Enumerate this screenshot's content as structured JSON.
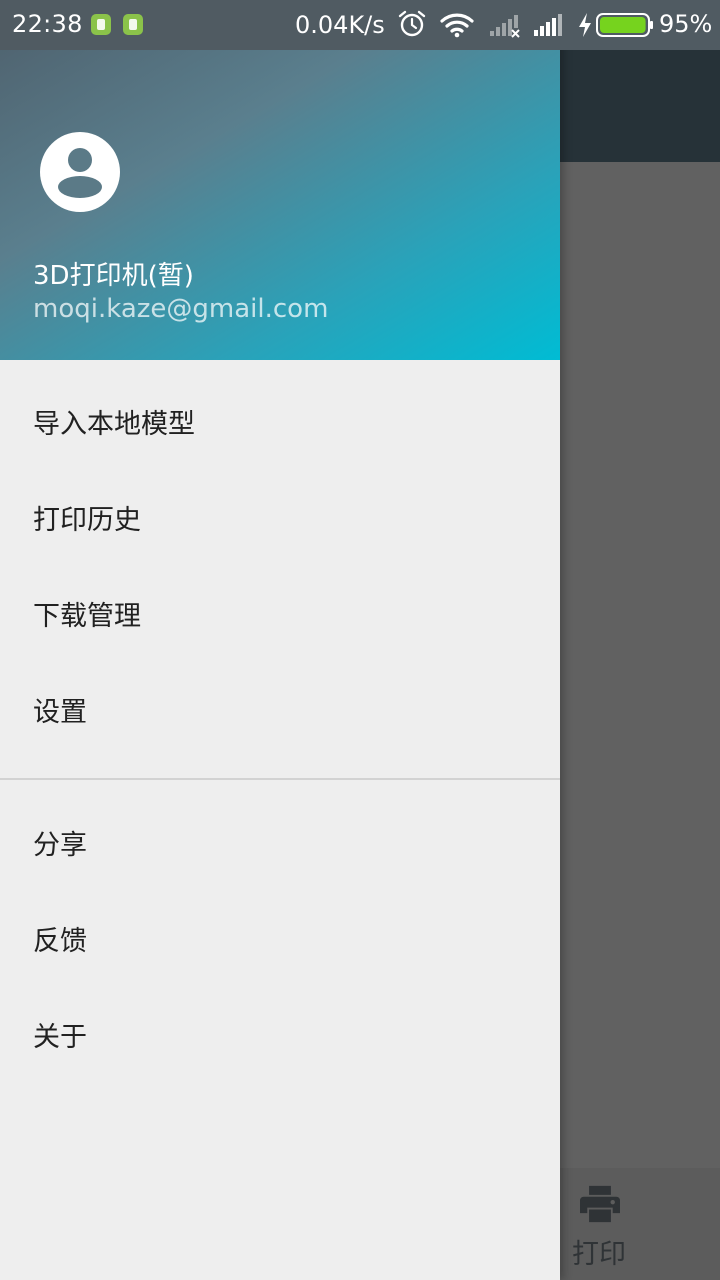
{
  "status_bar": {
    "time": "22:38",
    "net_speed": "0.04K/s",
    "battery_percent": "95%",
    "battery_level": 0.95,
    "icons": [
      "app-notification-icon",
      "android-notification-icon",
      "alarm-icon",
      "wifi-icon",
      "signal-icon",
      "signal-icon",
      "charging-icon",
      "battery-icon"
    ]
  },
  "drawer": {
    "profile": {
      "name": "3D打印机(暂)",
      "email": "moqi.kaze@gmail.com",
      "avatar_icon": "account-circle-icon"
    },
    "menu_primary": [
      {
        "label": "导入本地模型"
      },
      {
        "label": "打印历史"
      },
      {
        "label": "下载管理"
      },
      {
        "label": "设置"
      }
    ],
    "menu_secondary": [
      {
        "label": "分享"
      },
      {
        "label": "反馈"
      },
      {
        "label": "关于"
      }
    ]
  },
  "background": {
    "bottom_tab": {
      "label": "打印",
      "icon": "printer-icon"
    }
  },
  "colors": {
    "status_bar": "#505b62",
    "toolbar": "#263238",
    "header_gradient_start": "#4e5f6b",
    "header_gradient_end": "#00bcd4",
    "drawer_bg": "#eeeeee",
    "battery_fill": "#76d31e"
  }
}
